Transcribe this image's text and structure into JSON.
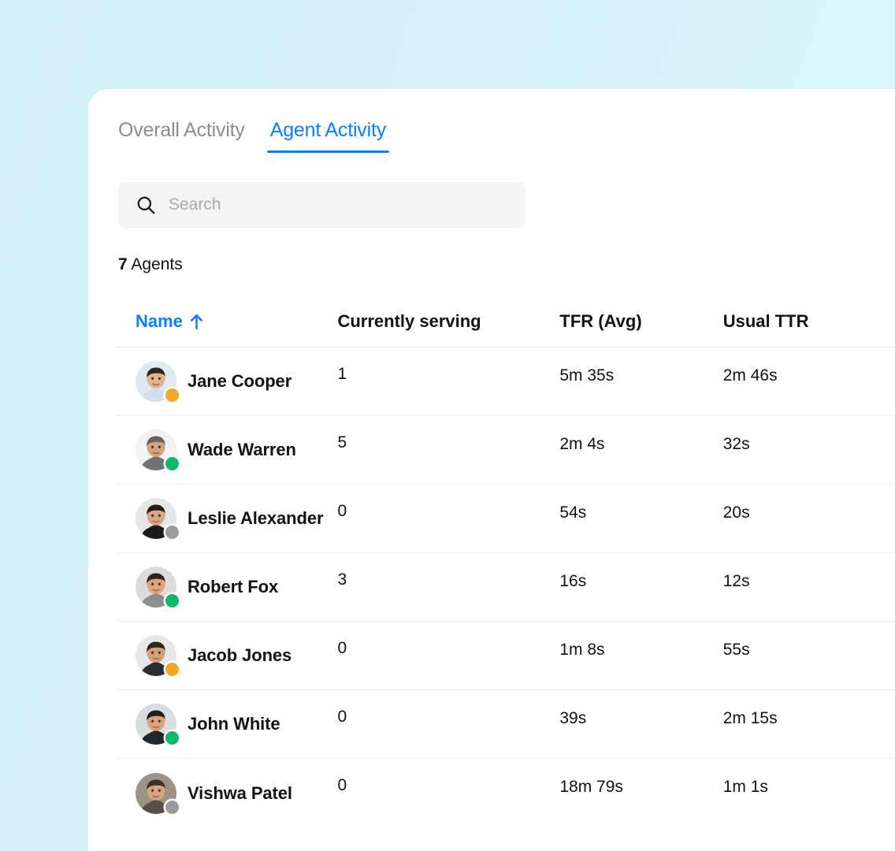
{
  "tabs": [
    {
      "label": "Overall Activity",
      "active": false
    },
    {
      "label": "Agent Activity",
      "active": true
    }
  ],
  "search": {
    "placeholder": "Search",
    "value": "",
    "icon": "search-icon"
  },
  "summary": {
    "count": "7",
    "count_label": " Agents"
  },
  "table": {
    "columns": [
      {
        "key": "name",
        "label": "Name",
        "sorted": true,
        "sort_direction": "asc",
        "sort_icon": "arrow-up-icon"
      },
      {
        "key": "serving",
        "label": "Currently serving"
      },
      {
        "key": "tfr",
        "label": "TFR (Avg)"
      },
      {
        "key": "ttr",
        "label": "Usual TTR"
      }
    ],
    "rows": [
      {
        "name": "Jane Cooper",
        "serving": "1",
        "tfr": "5m 35s",
        "ttr": "2m 46s",
        "status": "away"
      },
      {
        "name": "Wade Warren",
        "serving": "5",
        "tfr": "2m 4s",
        "ttr": "32s",
        "status": "online"
      },
      {
        "name": "Leslie Alexander",
        "serving": "0",
        "tfr": "54s",
        "ttr": "20s",
        "status": "offline"
      },
      {
        "name": "Robert Fox",
        "serving": "3",
        "tfr": "16s",
        "ttr": "12s",
        "status": "online"
      },
      {
        "name": "Jacob Jones",
        "serving": "0",
        "tfr": "1m 8s",
        "ttr": "55s",
        "status": "away"
      },
      {
        "name": "John White",
        "serving": "0",
        "tfr": "39s",
        "ttr": "2m 15s",
        "status": "online"
      },
      {
        "name": "Vishwa Patel",
        "serving": "0",
        "tfr": "18m 79s",
        "ttr": "1m 1s",
        "status": "offline"
      }
    ]
  },
  "colors": {
    "accent_blue": "#0D7DFF",
    "status_online": "#12B76A",
    "status_away": "#F5A623",
    "status_offline": "#9B9B9F",
    "text_primary": "#121217",
    "text_muted": "#8C8C92",
    "search_bg": "#F4F4F5",
    "background_start": "#D3EFFA",
    "background_end": "#DCF7F6"
  }
}
